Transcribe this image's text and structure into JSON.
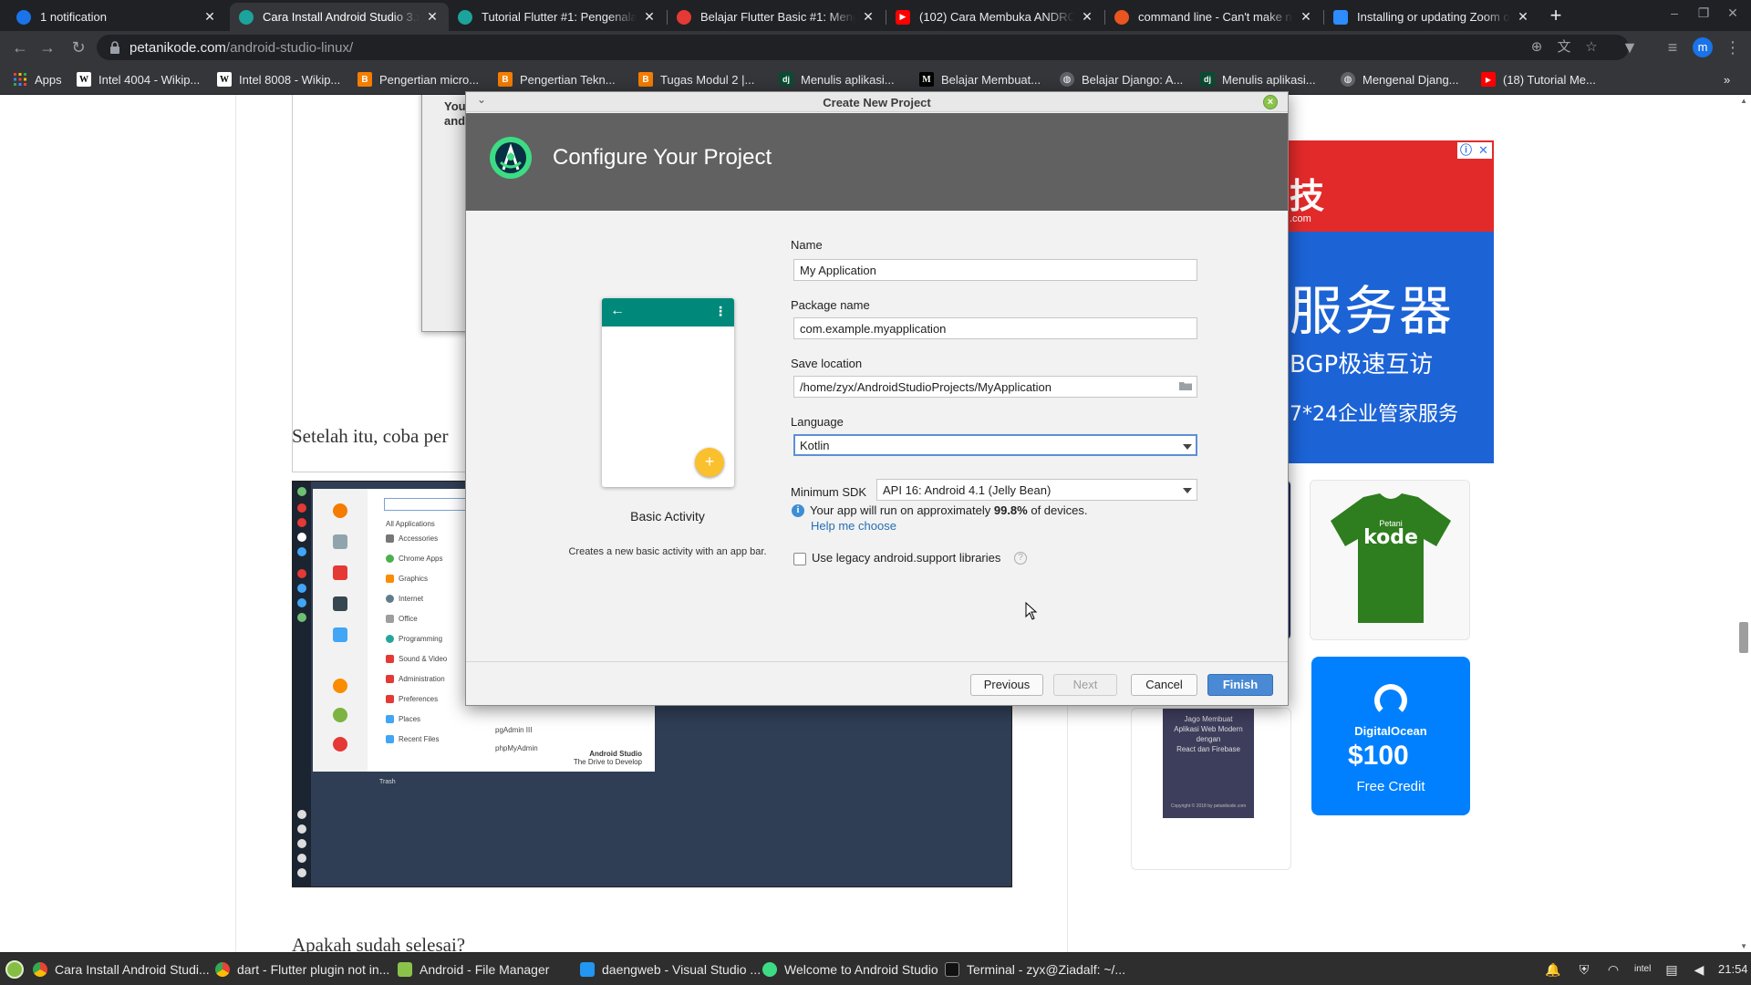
{
  "browser": {
    "tabs": [
      {
        "title": "1 notification",
        "favicon_color": "#1a73e8",
        "active": false
      },
      {
        "title": "Cara Install Android Studio 3.x",
        "favicon_color": "#1ba39c",
        "active": true
      },
      {
        "title": "Tutorial Flutter #1: Pengenalan",
        "favicon_color": "#1ba39c",
        "active": false
      },
      {
        "title": "Belajar Flutter Basic #1: Meng",
        "favicon_color": "#e53935",
        "active": false
      },
      {
        "title": "(102) Cara Membuka ANDROID",
        "favicon_color": "#ff0000",
        "active": false
      },
      {
        "title": "command line - Can't make ne",
        "favicon_color": "#e95420",
        "active": false
      },
      {
        "title": "Installing or updating Zoom o",
        "favicon_color": "#2d8cff",
        "active": false
      }
    ],
    "new_tab_glyph": "+",
    "url": {
      "host": "petanikode.com",
      "path": "/android-studio-linux/"
    },
    "profile_initial": "m",
    "bookmarks": [
      {
        "label": "Apps",
        "icon": "apps-grid-icon"
      },
      {
        "label": "Intel 4004 - Wikip...",
        "icon": "wikipedia-icon"
      },
      {
        "label": "Intel 8008 - Wikip...",
        "icon": "wikipedia-icon"
      },
      {
        "label": "Pengertian micro...",
        "icon": "blogger-icon"
      },
      {
        "label": "Pengertian Tekn...",
        "icon": "blogger-icon"
      },
      {
        "label": "Tugas Modul 2 |...",
        "icon": "blogger-icon"
      },
      {
        "label": "Menulis aplikasi...",
        "icon": "django-icon"
      },
      {
        "label": "Belajar Membuat...",
        "icon": "medium-icon"
      },
      {
        "label": "Belajar Django: A...",
        "icon": "globe-icon"
      },
      {
        "label": "Menulis aplikasi...",
        "icon": "django-icon"
      },
      {
        "label": "Mengenal Djang...",
        "icon": "globe-icon"
      },
      {
        "label": "(18) Tutorial Me...",
        "icon": "youtube-icon"
      }
    ],
    "overflow_glyph": "»"
  },
  "article": {
    "cutoff_dialog_text": [
      "You",
      "and"
    ],
    "paragraph_1": "Setelah itu, coba per",
    "paragraph_2": "Apakah sudah selesai?",
    "screenshot_menu": {
      "categories": [
        "All Applications",
        "Accessories",
        "Chrome Apps",
        "Graphics",
        "Internet",
        "Office",
        "Programming",
        "Sound & Video",
        "Administration",
        "Preferences",
        "Places",
        "Recent Files"
      ],
      "apps": [
        "pgAdmin III",
        "phpMyAdmin"
      ],
      "brand_title": "Android Studio",
      "brand_tagline": "The Drive to Develop",
      "trash_label": "Trash"
    }
  },
  "ads": {
    "big_ad": {
      "line1": "技",
      "line1_small": ".com",
      "line2": "服务器",
      "line3": "BGP极速互访",
      "line4": "7*24企业管家服务"
    },
    "shirt": {
      "brand_small": "Petani",
      "brand": "kode",
      "color": "#2e7d1e"
    },
    "book": {
      "text": [
        "Jago Membuat",
        "Aplikasi Web Modern",
        "dengan",
        "React dan Firebase"
      ],
      "footer": "Copyright © 2018 by petanikode.com"
    },
    "digitalocean": {
      "name": "DigitalOcean",
      "price": "$100",
      "subtitle": "Free Credit",
      "color": "#0080ff"
    }
  },
  "dialog": {
    "window_title": "Create New Project",
    "heading": "Configure Your Project",
    "template": {
      "name": "Basic Activity",
      "description": "Creates a new basic activity with an app bar."
    },
    "fields": {
      "name": {
        "label": "Name",
        "value": "My Application"
      },
      "package": {
        "label": "Package name",
        "value": "com.example.myapplication"
      },
      "save_location": {
        "label": "Save location",
        "value": "/home/zyx/AndroidStudioProjects/MyApplication"
      },
      "language": {
        "label": "Language",
        "value": "Kotlin"
      },
      "min_sdk": {
        "label": "Minimum SDK",
        "value": "API 16: Android 4.1 (Jelly Bean)"
      }
    },
    "info": {
      "prefix": "Your app will run on approximately ",
      "percent": "99.8%",
      "suffix": " of devices.",
      "help_link": "Help me choose"
    },
    "legacy_checkbox": {
      "label": "Use legacy android.support libraries",
      "checked": false
    },
    "buttons": {
      "previous": "Previous",
      "next": "Next",
      "cancel": "Cancel",
      "finish": "Finish"
    },
    "accent_color": "#4a8ad4",
    "header_color": "#616161"
  },
  "taskbar": {
    "items": [
      {
        "label": "Cara Install Android Studi...",
        "icon": "chrome-icon"
      },
      {
        "label": "dart - Flutter plugin not in...",
        "icon": "chrome-icon"
      },
      {
        "label": "Android - File Manager",
        "icon": "folder-icon"
      },
      {
        "label": "daengweb - Visual Studio ...",
        "icon": "vscode-icon"
      },
      {
        "label": "Welcome to Android Studio",
        "icon": "android-studio-icon"
      },
      {
        "label": "Terminal - zyx@Ziadalf: ~/...",
        "icon": "terminal-icon"
      }
    ],
    "clock": "21:54"
  }
}
